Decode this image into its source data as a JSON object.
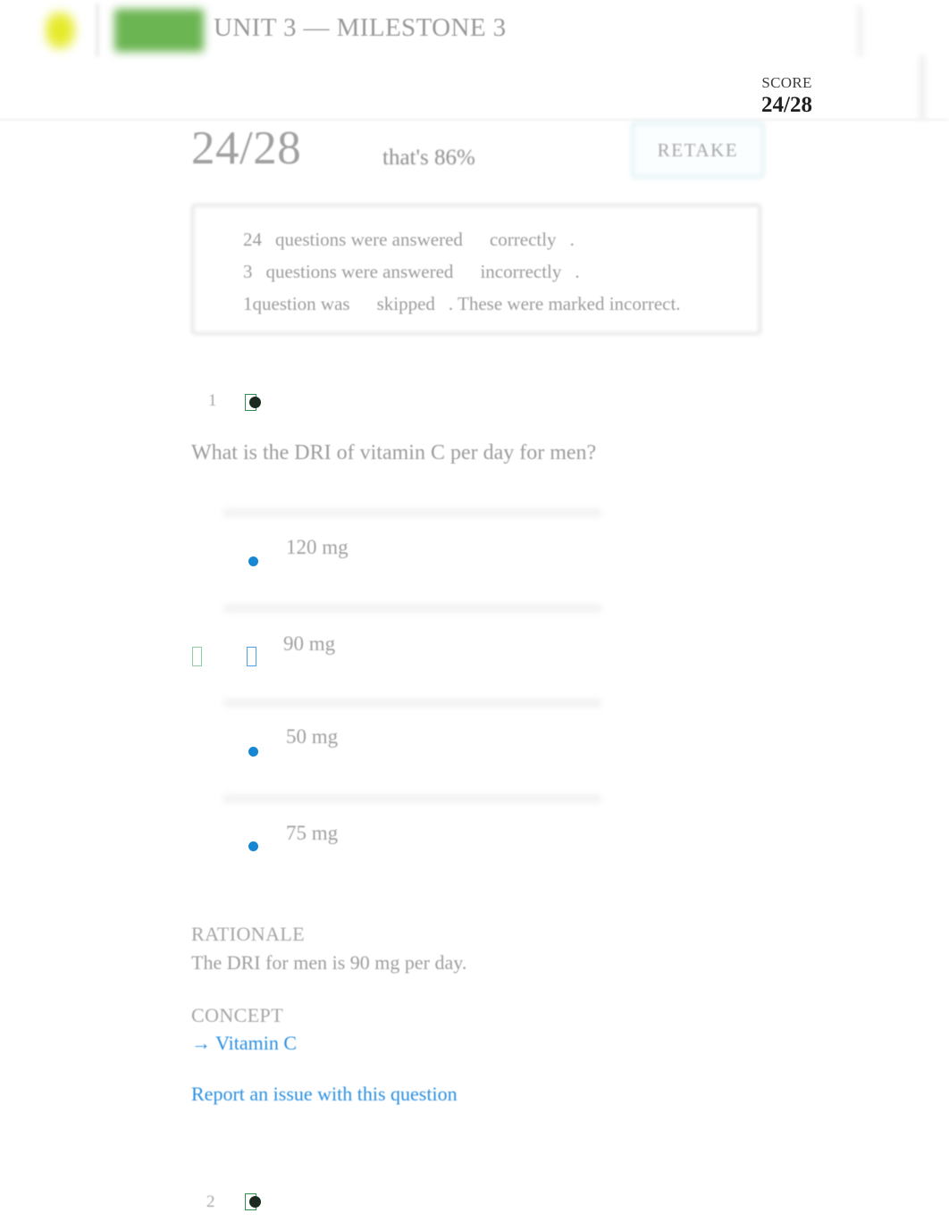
{
  "header": {
    "unit_title": "UNIT 3 — MILESTONE 3",
    "score_label": "SCORE",
    "score_value": "24/28",
    "logo_icon": "sophia-flame-logo-icon",
    "logo_wordmark": "sophia-wordmark"
  },
  "hero": {
    "score_fraction": "24/28",
    "percent_icon": "",
    "percent_text": "that's 86%",
    "retake_label": "RETAKE"
  },
  "summary": {
    "icon": "",
    "lines": [
      {
        "count": "24",
        "middle": "questions were answered",
        "emphasis": "correctly",
        "period": "."
      },
      {
        "count": "3",
        "middle": "questions were answered",
        "emphasis": "incorrectly",
        "period": "."
      },
      {
        "count": "1",
        "middle": "question was",
        "emphasis": "skipped",
        "period": ". These were marked incorrect."
      }
    ]
  },
  "questions": [
    {
      "number": "1",
      "status_icon": "correct-answer-marker-icon",
      "prompt": "What is the DRI of vitamin C per day for men?",
      "options": [
        {
          "label": "120 mg",
          "marker": "radio-dot",
          "selected": false,
          "correct": false
        },
        {
          "label": "90 mg",
          "marker": "chosen-glyph",
          "selected": true,
          "correct": true
        },
        {
          "label": "50 mg",
          "marker": "radio-dot",
          "selected": false,
          "correct": false
        },
        {
          "label": "75 mg",
          "marker": "radio-dot",
          "selected": false,
          "correct": false
        }
      ],
      "rationale_heading": "RATIONALE",
      "rationale_body": "The DRI for men is 90 mg per day.",
      "concept_heading": "CONCEPT",
      "concept_link": "→ Vitamin C",
      "report_link": "Report an issue with this question"
    },
    {
      "number": "2",
      "status_icon": "correct-answer-marker-icon"
    }
  ],
  "colors": {
    "accent_blue": "#1787d4",
    "link_blue": "#2a8fe0",
    "correct_green": "#2f8f4e",
    "logo_green": "#6cb553",
    "logo_yellow": "#e3e820",
    "retake_border": "#cce7ef",
    "muted_text": "#9e9e9e"
  }
}
